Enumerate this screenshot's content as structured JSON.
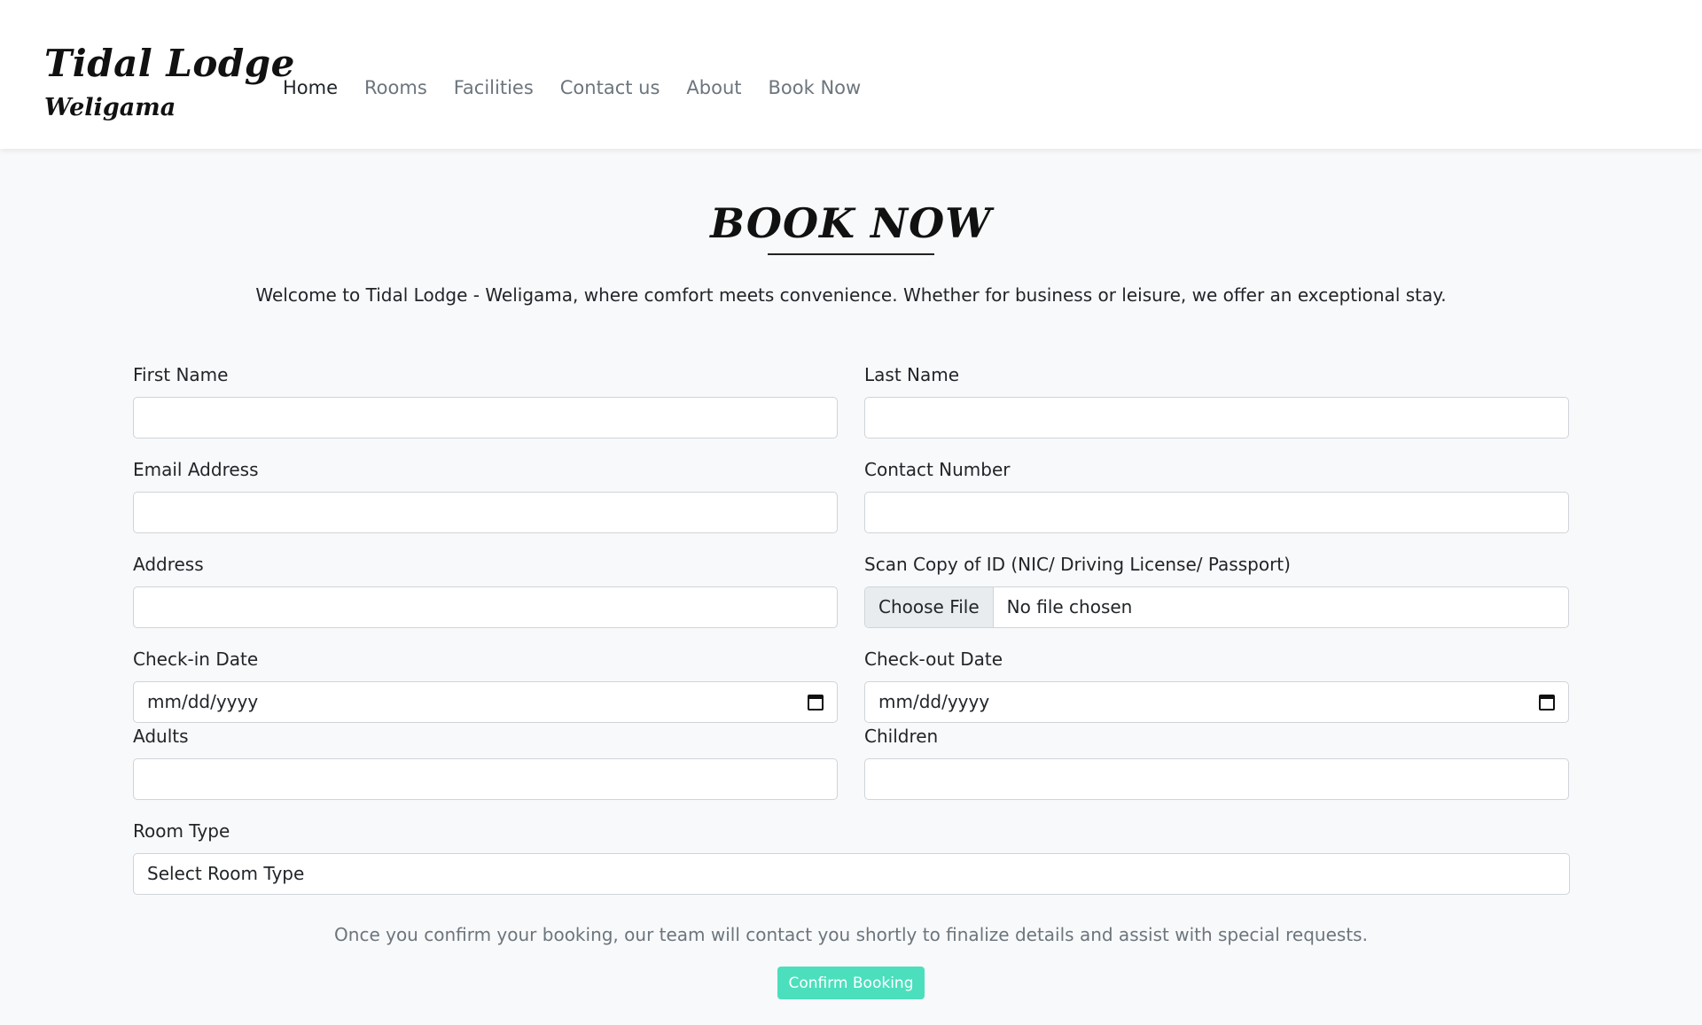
{
  "brand": {
    "name": "Tidal Lodge",
    "location": "Weligama"
  },
  "nav": [
    {
      "label": "Home",
      "active": true
    },
    {
      "label": "Rooms",
      "active": false
    },
    {
      "label": "Facilities",
      "active": false
    },
    {
      "label": "Contact us",
      "active": false
    },
    {
      "label": "About",
      "active": false
    },
    {
      "label": "Book Now",
      "active": false
    }
  ],
  "page": {
    "title": "BOOK NOW",
    "intro": "Welcome to Tidal Lodge - Weligama, where comfort meets convenience. Whether for business or leisure, we offer an exceptional stay."
  },
  "form": {
    "first_name": {
      "label": "First Name",
      "value": ""
    },
    "last_name": {
      "label": "Last Name",
      "value": ""
    },
    "email": {
      "label": "Email Address",
      "value": ""
    },
    "contact": {
      "label": "Contact Number",
      "value": ""
    },
    "address": {
      "label": "Address",
      "value": ""
    },
    "id_scan": {
      "label": "Scan Copy of ID (NIC/ Driving License/ Passport)",
      "button": "Choose File",
      "status": "No file chosen"
    },
    "check_in": {
      "label": "Check-in Date",
      "placeholder": "mm/dd/yyyy"
    },
    "check_out": {
      "label": "Check-out Date",
      "placeholder": "mm/dd/yyyy"
    },
    "adults": {
      "label": "Adults",
      "value": ""
    },
    "children": {
      "label": "Children",
      "value": ""
    },
    "room_type": {
      "label": "Room Type",
      "selected": "Select Room Type"
    }
  },
  "footer_note": "Once you confirm your booking, our team will contact you shortly to finalize details and assist with special requests.",
  "confirm_button": "Confirm Booking",
  "colors": {
    "accent": "#4bdfbd",
    "page_bg": "#f8f9fa",
    "header_bg": "#ffffff"
  }
}
